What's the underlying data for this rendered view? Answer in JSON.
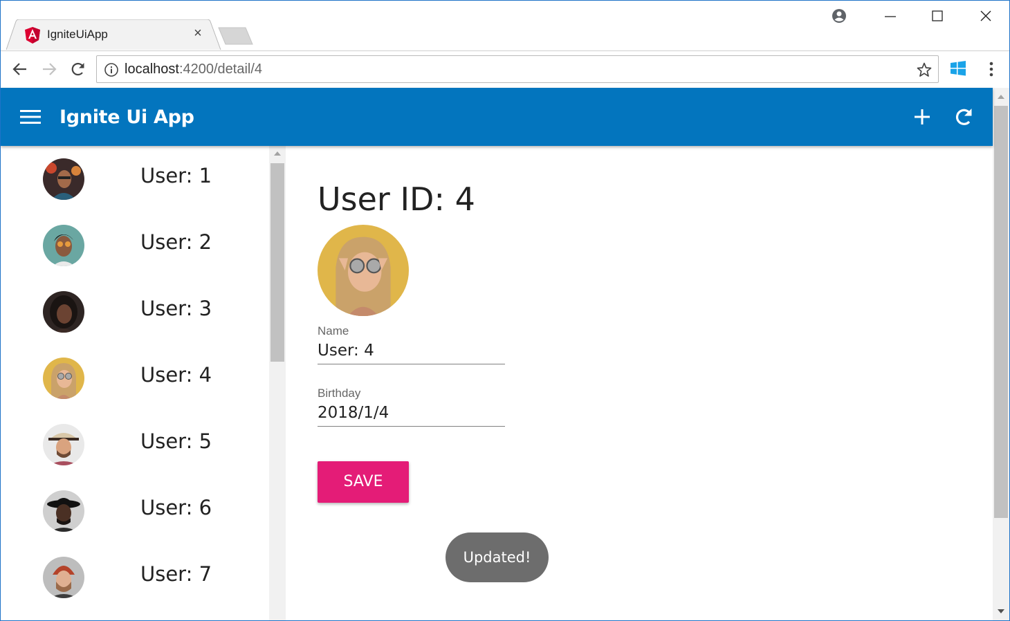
{
  "browser": {
    "tab_title": "IgniteUiApp",
    "tab_close": "×",
    "url_host": "localhost",
    "url_path": ":4200/detail/4"
  },
  "app": {
    "title": "Ignite Ui App",
    "brand_color": "#0375be",
    "accent_color": "#e41c77"
  },
  "sidebar": {
    "users": [
      {
        "label": "User: 1",
        "avatar": "avatar-user-1"
      },
      {
        "label": "User: 2",
        "avatar": "avatar-user-2"
      },
      {
        "label": "User: 3",
        "avatar": "avatar-user-3"
      },
      {
        "label": "User: 4",
        "avatar": "avatar-user-4"
      },
      {
        "label": "User: 5",
        "avatar": "avatar-user-5"
      },
      {
        "label": "User: 6",
        "avatar": "avatar-user-6"
      },
      {
        "label": "User: 7",
        "avatar": "avatar-user-7"
      }
    ]
  },
  "detail": {
    "title": "User ID: 4",
    "name_label": "Name",
    "name_value": "User: 4",
    "birthday_label": "Birthday",
    "birthday_value": "2018/1/4",
    "save_label": "SAVE",
    "toast": "Updated!"
  }
}
